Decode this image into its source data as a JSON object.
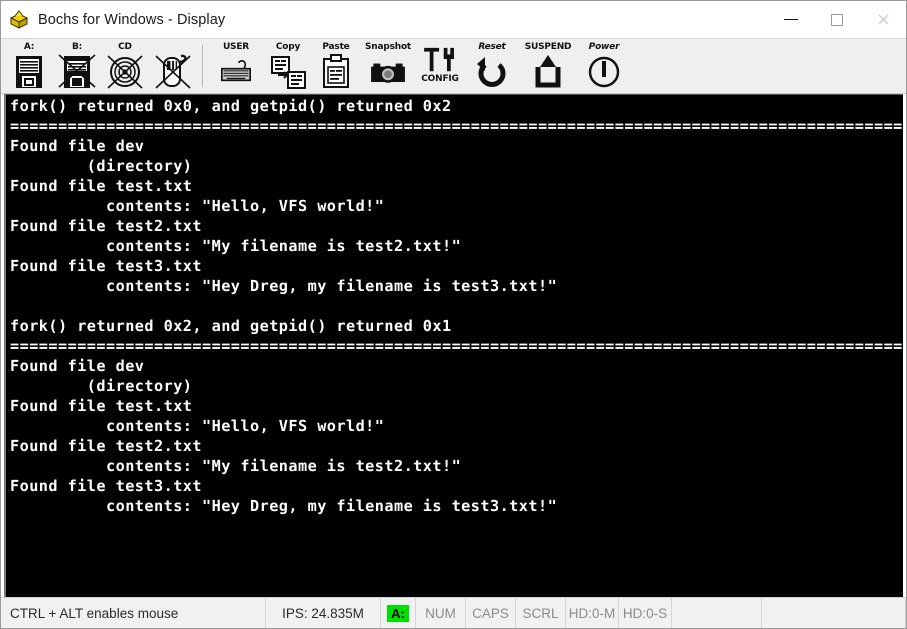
{
  "window": {
    "title": "Bochs for Windows - Display",
    "icon": "bochs-box-icon",
    "minimize_label": "Minimize",
    "maximize_label": "Maximize",
    "close_label": "Close"
  },
  "toolbar": {
    "buttons": [
      {
        "id": "floppy-a",
        "label": "A:",
        "icon": "floppy-disk-a-icon"
      },
      {
        "id": "floppy-b",
        "label": "B:",
        "icon": "floppy-disk-b-icon"
      },
      {
        "id": "cdrom",
        "label": "CD",
        "icon": "cdrom-disc-icon"
      },
      {
        "id": "mouse",
        "label": "",
        "icon": "mouse-disabled-icon"
      },
      {
        "id": "user",
        "label": "USER",
        "icon": "keyboard-icon"
      },
      {
        "id": "copy",
        "label": "Copy",
        "icon": "copy-icon"
      },
      {
        "id": "paste",
        "label": "Paste",
        "icon": "paste-clipboard-icon"
      },
      {
        "id": "snapshot",
        "label": "Snapshot",
        "icon": "camera-snapshot-icon"
      },
      {
        "id": "config",
        "label": "CONFIG",
        "icon": "tools-config-icon"
      },
      {
        "id": "reset",
        "label": "Reset",
        "icon": "reset-arrow-icon"
      },
      {
        "id": "suspend",
        "label": "SUSPEND",
        "icon": "suspend-icon"
      },
      {
        "id": "power",
        "label": "Power",
        "icon": "power-icon"
      }
    ]
  },
  "display": {
    "text": "fork() returned 0x0, and getpid() returned 0x2\n=====================================================================================================\nFound file dev\n        (directory)\nFound file test.txt\n          contents: \"Hello, VFS world!\"\nFound file test2.txt\n          contents: \"My filename is test2.txt!\"\nFound file test3.txt\n          contents: \"Hey Dreg, my filename is test3.txt!\"\n\nfork() returned 0x2, and getpid() returned 0x1\n=====================================================================================================\nFound file dev\n        (directory)\nFound file test.txt\n          contents: \"Hello, VFS world!\"\nFound file test2.txt\n          contents: \"My filename is test2.txt!\"\nFound file test3.txt\n          contents: \"Hey Dreg, my filename is test3.txt!\"",
    "background_color": "#000000",
    "text_color": "#ffffff"
  },
  "statusbar": {
    "message": "CTRL + ALT enables mouse",
    "ips": "IPS: 24.835M",
    "floppy_led": "A:",
    "floppy_led_color": "#00e000",
    "indicators": [
      {
        "id": "num",
        "label": "NUM"
      },
      {
        "id": "caps",
        "label": "CAPS"
      },
      {
        "id": "scrl",
        "label": "SCRL"
      },
      {
        "id": "hd0m",
        "label": "HD:0-M"
      },
      {
        "id": "hd0s",
        "label": "HD:0-S"
      }
    ]
  }
}
